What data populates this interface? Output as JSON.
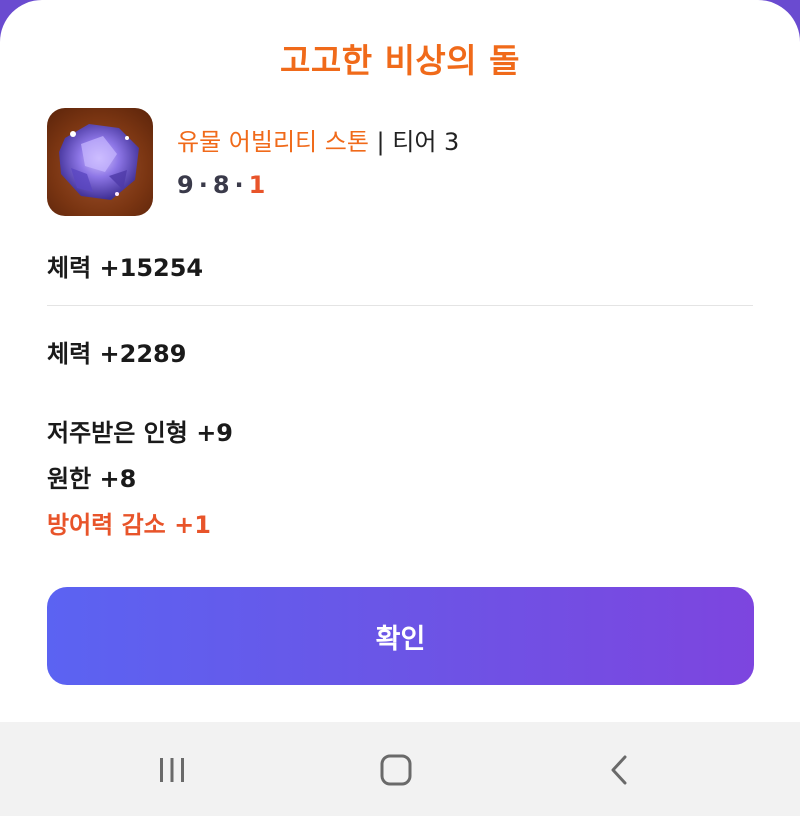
{
  "dialog": {
    "title": "고고한 비상의 돌",
    "item": {
      "icon": "amethyst-stone-icon",
      "name": "유물 어빌리티 스톤",
      "separator": " | ",
      "tier": "티어 3",
      "levels": [
        "9",
        "8",
        "1"
      ]
    },
    "stats": [
      "체력 +15254",
      "체력 +2289"
    ],
    "engravings": [
      "저주받은 인형 +9",
      "원한 +8"
    ],
    "penalty": "방어력 감소 +1",
    "confirm_label": "확인"
  },
  "colors": {
    "accent_orange": "#f06a1a",
    "penalty_red": "#e8542a",
    "button_start": "#5b63f2",
    "button_end": "#7d45df"
  },
  "navbar": {
    "recent_icon": "recent-apps-icon",
    "home_icon": "home-icon",
    "back_icon": "back-icon"
  }
}
